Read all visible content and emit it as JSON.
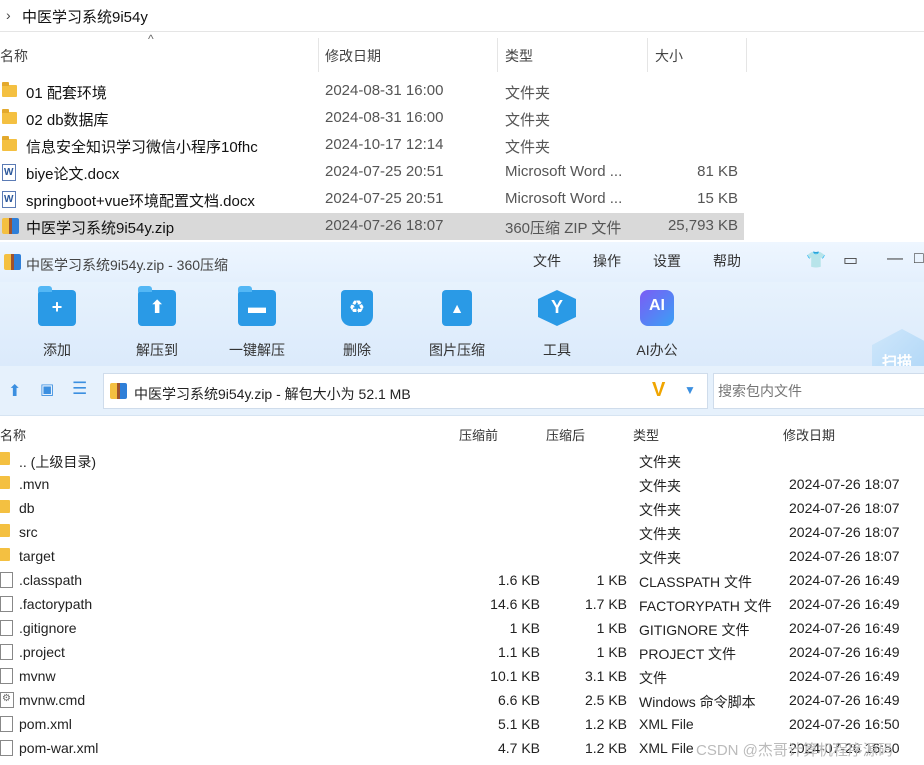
{
  "explorer": {
    "breadcrumb": "中医学习系统9i54y",
    "columns": [
      "名称",
      "修改日期",
      "类型",
      "大小"
    ],
    "files": [
      {
        "name": "01 配套环境",
        "date": "2024-08-31 16:00",
        "type": "文件夹",
        "size": "",
        "icon": "folder-icon"
      },
      {
        "name": "02 db数据库",
        "date": "2024-08-31 16:00",
        "type": "文件夹",
        "size": "",
        "icon": "folder-icon"
      },
      {
        "name": "信息安全知识学习微信小程序10fhc",
        "date": "2024-10-17 12:14",
        "type": "文件夹",
        "size": "",
        "icon": "folder-icon"
      },
      {
        "name": "biye论文.docx",
        "date": "2024-07-25 20:51",
        "type": "Microsoft Word ...",
        "size": "81 KB",
        "icon": "docx-icon"
      },
      {
        "name": "springboot+vue环境配置文档.docx",
        "date": "2024-07-25 20:51",
        "type": "Microsoft Word ...",
        "size": "15 KB",
        "icon": "docx-icon"
      },
      {
        "name": "中医学习系统9i54y.zip",
        "date": "2024-07-26 18:07",
        "type": "360压缩 ZIP 文件",
        "size": "25,793 KB",
        "icon": "zip-icon"
      }
    ]
  },
  "app": {
    "title": "中医学习系统9i54y.zip - 360压缩",
    "menu": [
      "文件",
      "操作",
      "设置",
      "帮助"
    ],
    "tools": [
      {
        "label": "添加",
        "icon": "add-icon"
      },
      {
        "label": "解压到",
        "icon": "extract-to-icon"
      },
      {
        "label": "一键解压",
        "icon": "one-click-extract-icon"
      },
      {
        "label": "删除",
        "icon": "delete-icon"
      },
      {
        "label": "图片压缩",
        "icon": "image-compress-icon"
      },
      {
        "label": "工具",
        "icon": "tools-icon"
      },
      {
        "label": "AI办公",
        "icon": "ai-office-icon"
      }
    ],
    "scan_label": "扫描",
    "path_text": "中医学习系统9i54y.zip - 解包大小为 52.1 MB",
    "search_placeholder": "搜索包内文件",
    "columns": [
      "名称",
      "压缩前",
      "压缩后",
      "类型",
      "修改日期"
    ],
    "entries": [
      {
        "name": ".. (上级目录)",
        "before": "",
        "after": "",
        "type": "文件夹",
        "modified": "",
        "icon": "folder-icon"
      },
      {
        "name": ".mvn",
        "before": "",
        "after": "",
        "type": "文件夹",
        "modified": "2024-07-26 18:07",
        "icon": "folder-icon"
      },
      {
        "name": "db",
        "before": "",
        "after": "",
        "type": "文件夹",
        "modified": "2024-07-26 18:07",
        "icon": "folder-icon"
      },
      {
        "name": "src",
        "before": "",
        "after": "",
        "type": "文件夹",
        "modified": "2024-07-26 18:07",
        "icon": "folder-icon"
      },
      {
        "name": "target",
        "before": "",
        "after": "",
        "type": "文件夹",
        "modified": "2024-07-26 18:07",
        "icon": "folder-icon"
      },
      {
        "name": ".classpath",
        "before": "1.6 KB",
        "after": "1 KB",
        "type": "CLASSPATH 文件",
        "modified": "2024-07-26 16:49",
        "icon": "file-icon"
      },
      {
        "name": ".factorypath",
        "before": "14.6 KB",
        "after": "1.7 KB",
        "type": "FACTORYPATH 文件",
        "modified": "2024-07-26 16:49",
        "icon": "file-icon"
      },
      {
        "name": ".gitignore",
        "before": "1 KB",
        "after": "1 KB",
        "type": "GITIGNORE 文件",
        "modified": "2024-07-26 16:49",
        "icon": "file-icon"
      },
      {
        "name": ".project",
        "before": "1.1 KB",
        "after": "1 KB",
        "type": "PROJECT 文件",
        "modified": "2024-07-26 16:49",
        "icon": "file-icon"
      },
      {
        "name": "mvnw",
        "before": "10.1 KB",
        "after": "3.1 KB",
        "type": "文件",
        "modified": "2024-07-26 16:49",
        "icon": "file-icon"
      },
      {
        "name": "mvnw.cmd",
        "before": "6.6 KB",
        "after": "2.5 KB",
        "type": "Windows 命令脚本",
        "modified": "2024-07-26 16:49",
        "icon": "cmd-icon"
      },
      {
        "name": "pom.xml",
        "before": "5.1 KB",
        "after": "1.2 KB",
        "type": "XML File",
        "modified": "2024-07-26 16:50",
        "icon": "file-icon"
      },
      {
        "name": "pom-war.xml",
        "before": "4.7 KB",
        "after": "1.2 KB",
        "type": "XML File",
        "modified": "2024-07-26 16:50",
        "icon": "file-icon"
      }
    ]
  },
  "watermark": "CSDN @杰哥计算机程序源码"
}
